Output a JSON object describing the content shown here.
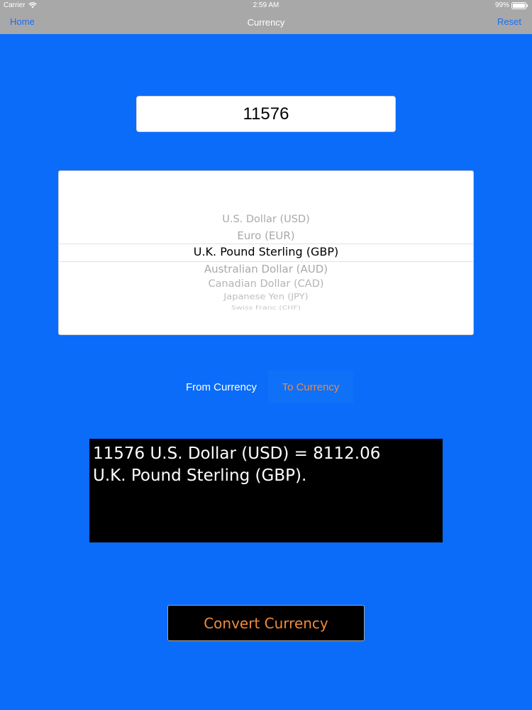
{
  "status_bar": {
    "carrier": "Carrier",
    "time": "2:59 AM",
    "battery": "99%"
  },
  "nav": {
    "home_label": "Home",
    "title": "Currency",
    "reset_label": "Reset"
  },
  "amount": {
    "value": "11576"
  },
  "picker": {
    "selected_index": 2,
    "options": [
      "U.S. Dollar (USD)",
      "Euro (EUR)",
      "U.K. Pound Sterling (GBP)",
      "Australian Dollar (AUD)",
      "Canadian Dollar (CAD)",
      "Japanese Yen (JPY)",
      "Swiss Franc (CHF)"
    ]
  },
  "segments": {
    "from_label": "From Currency",
    "to_label": "To Currency",
    "active": "to"
  },
  "result": {
    "line1": "11576 U.S. Dollar (USD) = 8112.06",
    "line2": "U.K. Pound Sterling (GBP)."
  },
  "convert_label": "Convert Currency",
  "colors": {
    "background": "#0a6cf9",
    "nav_bar": "#a8a8a8",
    "accent_orange": "#f08a3a",
    "link_blue": "#1a6ef5"
  }
}
